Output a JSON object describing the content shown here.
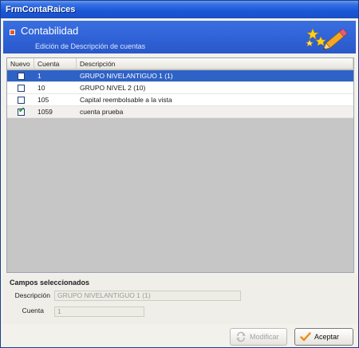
{
  "window": {
    "title": "FrmContaRaices"
  },
  "header": {
    "title": "Contabilidad",
    "subtitle": "Edición de Descripción de cuentas",
    "logo_icon": "stars-pencil-icon"
  },
  "grid": {
    "columns": [
      "Nuevo",
      "Cuenta",
      "Descripción"
    ],
    "rows": [
      {
        "nuevo": false,
        "cuenta": "1",
        "descripcion": "GRUPO NIVELANTIGUO 1 (1)",
        "selected": true
      },
      {
        "nuevo": false,
        "cuenta": "10",
        "descripcion": "GRUPO NIVEL 2 (10)",
        "selected": false
      },
      {
        "nuevo": false,
        "cuenta": "105",
        "descripcion": "Capital reembolsable a la vista",
        "selected": false
      },
      {
        "nuevo": true,
        "cuenta": "1059",
        "descripcion": "cuenta prueba",
        "selected": false
      }
    ]
  },
  "campos": {
    "title": "Campos seleccionados",
    "descripcion_label": "Descripción",
    "descripcion_value": "GRUPO NIVELANTIGUO 1 (1)",
    "cuenta_label": "Cuenta",
    "cuenta_value": "1"
  },
  "buttons": {
    "modificar": "Modificar",
    "aceptar": "Aceptar"
  },
  "colors": {
    "header_blue": "#2f62d6",
    "selection_blue": "#2f62c7",
    "check_green": "#1f8a1f"
  }
}
